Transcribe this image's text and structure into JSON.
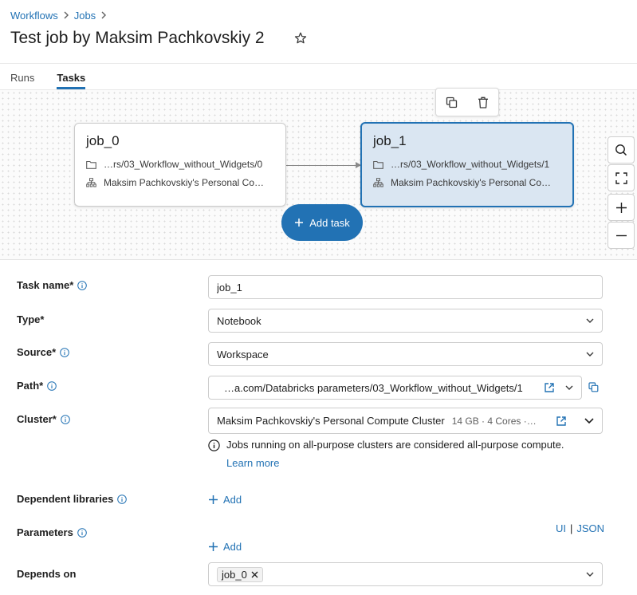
{
  "breadcrumb": {
    "items": [
      "Workflows",
      "Jobs"
    ]
  },
  "page": {
    "title": "Test job by Maksim Pachkovskiy 2"
  },
  "tabs": [
    {
      "label": "Runs"
    },
    {
      "label": "Tasks"
    }
  ],
  "graph": {
    "nodes": [
      {
        "title": "job_0",
        "path": "…rs/03_Workflow_without_Widgets/0",
        "cluster": "Maksim Pachkovskiy's Personal Co…"
      },
      {
        "title": "job_1",
        "path": "…rs/03_Workflow_without_Widgets/1",
        "cluster": "Maksim Pachkovskiy's Personal Co…"
      }
    ],
    "add_task_label": "Add task"
  },
  "form": {
    "task_name": {
      "label": "Task name*",
      "value": "job_1"
    },
    "type": {
      "label": "Type*",
      "value": "Notebook"
    },
    "source": {
      "label": "Source*",
      "value": "Workspace"
    },
    "path": {
      "label": "Path*",
      "value": "…a.com/Databricks parameters/03_Workflow_without_Widgets/1"
    },
    "cluster": {
      "label": "Cluster*",
      "value": "Maksim Pachkovskiy's Personal Compute Cluster",
      "detail": "14 GB · 4 Cores ·…"
    },
    "notice": {
      "text": "Jobs running on all-purpose clusters are considered all-purpose compute.",
      "link": "Learn more"
    },
    "libraries": {
      "label": "Dependent libraries",
      "add_label": "Add"
    },
    "parameters": {
      "label": "Parameters",
      "add_label": "Add",
      "ui_link": "UI",
      "separator": "|",
      "json_link": "JSON"
    },
    "depends_on": {
      "label": "Depends on",
      "tag": "job_0"
    }
  },
  "colors": {
    "accent": "#2272b4",
    "selected_bg": "#dae6f2"
  }
}
